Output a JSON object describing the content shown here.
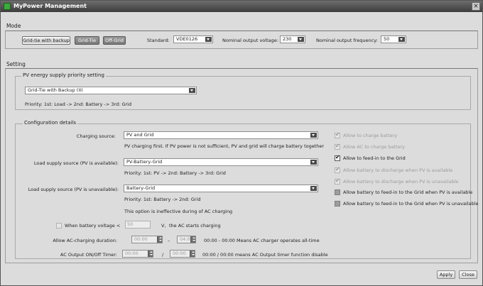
{
  "window": {
    "title": "MyPower Management",
    "close_glyph": "×"
  },
  "mode": {
    "section_label": "Mode",
    "buttons": [
      {
        "label": "Grid-tie with backup",
        "state": "selected"
      },
      {
        "label": "Grid-Tie",
        "state": "pressed"
      },
      {
        "label": "Off-Grid",
        "state": "pressed"
      }
    ],
    "standard_label": "Standard:",
    "standard_value": "VDE0126",
    "voltage_label": "Nominal output voltage:",
    "voltage_value": "230",
    "frequency_label": "Nominal output frequency:",
    "frequency_value": "50"
  },
  "setting": {
    "section_label": "Setting",
    "pv_priority": {
      "legend": "PV energy supply priority setting",
      "selected": "Grid-Tie with Backup (II)",
      "priority_text": "Priority: 1st: Load -> 2nd: Battery -> 3rd: Grid"
    },
    "config": {
      "legend": "Configuration details",
      "charging_source_label": "Charging source:",
      "charging_source_value": "PV and Grid",
      "charging_source_note": "PV charging first. If PV power is not sufficient, PV and grid will charge battery together",
      "load_pv_available_label": "Load supply source (PV is available):",
      "load_pv_available_value": "PV-Battery-Grid",
      "load_pv_available_note": "Priority: 1st: PV -> 2nd: Battery -> 3rd: Grid",
      "load_pv_unavailable_label": "Load supply source (PV is unavailable):",
      "load_pv_unavailable_value": "Battery-Grid",
      "load_pv_unavailable_note": "Priority: 1st: Battery -> 2nd: Grid",
      "ac_note": "This option is ineffective during of AC charging",
      "battery_voltage_label": "When battery voltage <",
      "battery_voltage_value": "50",
      "battery_voltage_unit": "V,",
      "battery_voltage_tail": "the AC starts charging",
      "ac_charge_duration_label": "Allow AC-charging duration:",
      "ac_charge_start": "00:00",
      "ac_charge_dash": "–",
      "ac_charge_end": "04:00",
      "ac_charge_note": "00:00 - 00:00 Means AC charger operates all-time",
      "ac_output_timer_label": "AC Output ON/Off Timer:",
      "ac_output_start": "00:00",
      "ac_output_slash": "/",
      "ac_output_end": "00:00",
      "ac_output_note": "00:00 / 00:00 means AC Output timer function disable",
      "checkboxes": [
        {
          "label": "Allow to charge battery",
          "checked": true,
          "enabled": false
        },
        {
          "label": "Allow AC to charge battery",
          "checked": true,
          "enabled": false
        },
        {
          "label": "Allow to feed-in to the Grid",
          "checked": true,
          "enabled": true
        },
        {
          "label": "Allow battery to discharge when PV is available",
          "checked": true,
          "enabled": false
        },
        {
          "label": "Allow battery to discharge when PV is unavailable",
          "checked": true,
          "enabled": false
        },
        {
          "label": "Allow battery to feed-in to the Grid when PV is available",
          "checked": false,
          "enabled": true
        },
        {
          "label": "Allow battery to feed-in to the Grid when PV is unavailable",
          "checked": false,
          "enabled": true
        }
      ]
    }
  },
  "footer": {
    "apply_label": "Apply",
    "close_label": "Close"
  }
}
